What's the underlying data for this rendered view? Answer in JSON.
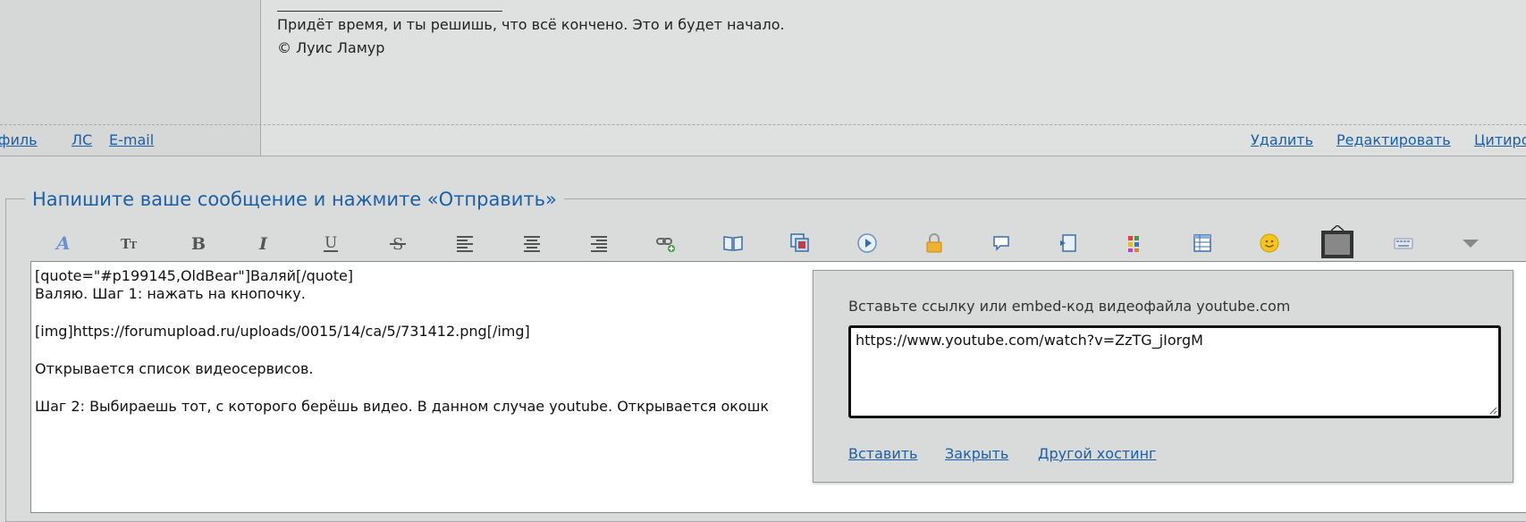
{
  "post": {
    "signature_quote": "Придёт время, и ты решишь, что всё кончено. Это и будет начало.",
    "signature_author": "© Луис Ламур",
    "left_links": {
      "profile": "офиль",
      "pm": "ЛС",
      "email": "E-mail"
    },
    "right_links": {
      "delete": "Удалить",
      "edit": "Редактировать",
      "quote": "Цитиро"
    }
  },
  "form": {
    "legend": "Напишите ваше сообщение и нажмите «Отправить»"
  },
  "toolbar": {
    "buttons": [
      "font-icon",
      "text-size-icon",
      "bold-icon",
      "italic-icon",
      "underline-icon",
      "strikethrough-icon",
      "align-left-icon",
      "align-center-icon",
      "align-right-icon",
      "link-add-icon",
      "book-icon",
      "images-icon",
      "video-play-icon",
      "lock-icon",
      "speech-bubble-icon",
      "script-icon",
      "color-palette-icon",
      "table-icon",
      "smiley-icon",
      "tv-frame-icon",
      "keyboard-icon",
      "dropdown-arrow-icon"
    ]
  },
  "editor": {
    "lines": [
      "[quote=\"#p199145,OldBear\"]Валяй[/quote]",
      "Валяю. Шаг 1: нажать на кнопочку.",
      "",
      "[img]https://forumupload.ru/uploads/0015/14/ca/5/731412.png[/img]",
      "",
      "Открывается список видеосервисов.",
      "",
      "Шаг 2: Выбираешь тот, с которого берёшь видео. В данном случае youtube. Открывается окошк"
    ]
  },
  "popup": {
    "label": "Вставьте ссылку или embed-код видеофайла youtube.com",
    "input_value": "https://www.youtube.com/watch?v=ZzTG_jIorgM",
    "insert": "Вставить",
    "close": "Закрыть",
    "other_hosting": "Другой хостинг"
  },
  "colors": {
    "link": "#1a5fa8",
    "background": "#dadcdc"
  }
}
